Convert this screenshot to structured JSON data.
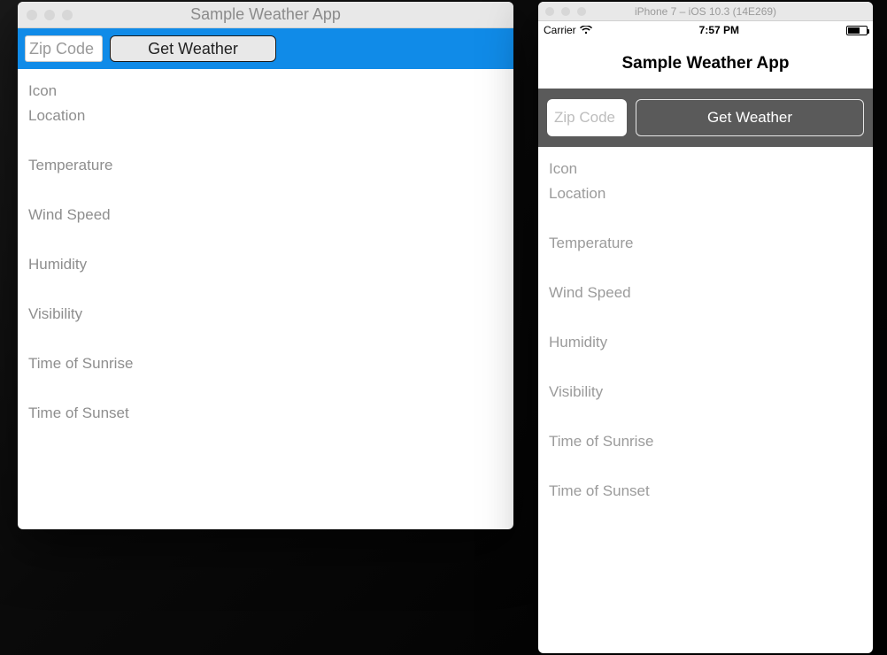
{
  "mac": {
    "title": "Sample Weather App",
    "zip_placeholder": "Zip Code",
    "get_button": "Get Weather",
    "fields": {
      "icon": "Icon",
      "location": "Location",
      "temperature": "Temperature",
      "wind_speed": "Wind Speed",
      "humidity": "Humidity",
      "visibility": "Visibility",
      "sunrise": "Time of Sunrise",
      "sunset": "Time of Sunset"
    }
  },
  "sim": {
    "title": "iPhone 7 – iOS 10.3 (14E269)",
    "status": {
      "carrier": "Carrier",
      "time": "7:57 PM"
    },
    "nav_title": "Sample Weather App",
    "zip_placeholder": "Zip Code",
    "get_button": "Get Weather",
    "fields": {
      "icon": "Icon",
      "location": "Location",
      "temperature": "Temperature",
      "wind_speed": "Wind Speed",
      "humidity": "Humidity",
      "visibility": "Visibility",
      "sunrise": "Time of Sunrise",
      "sunset": "Time of Sunset"
    }
  }
}
